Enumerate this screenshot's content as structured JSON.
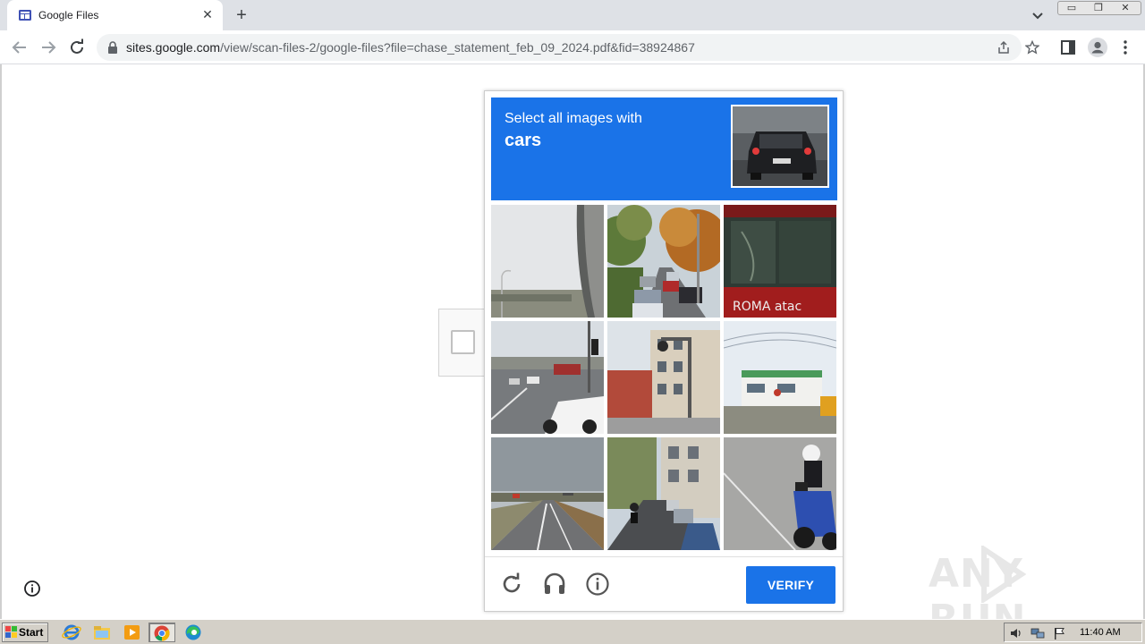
{
  "browser": {
    "tab_title": "Google Files",
    "url_host": "sites.google.com",
    "url_path": "/view/scan-files-2/google-files?file=chase_statement_feb_09_2024.pdf&fid=38924867"
  },
  "captcha": {
    "instruction": "Select all images with",
    "target": "cars",
    "verify_label": "VERIFY",
    "tiles": [
      "overpass-road",
      "street-traffic-cars",
      "bus-roma",
      "intersection-white-car",
      "building-traffic-light",
      "building-fisheye",
      "highway",
      "street-parked-cars",
      "motorcycle"
    ],
    "bus_text": "ROMA atac"
  },
  "watermark": "ANY RUN",
  "taskbar": {
    "start_label": "Start",
    "clock": "11:40 AM"
  },
  "colors": {
    "accent": "#1a73e8",
    "tabbar": "#dee1e6",
    "taskbar": "#d4d0c8"
  }
}
